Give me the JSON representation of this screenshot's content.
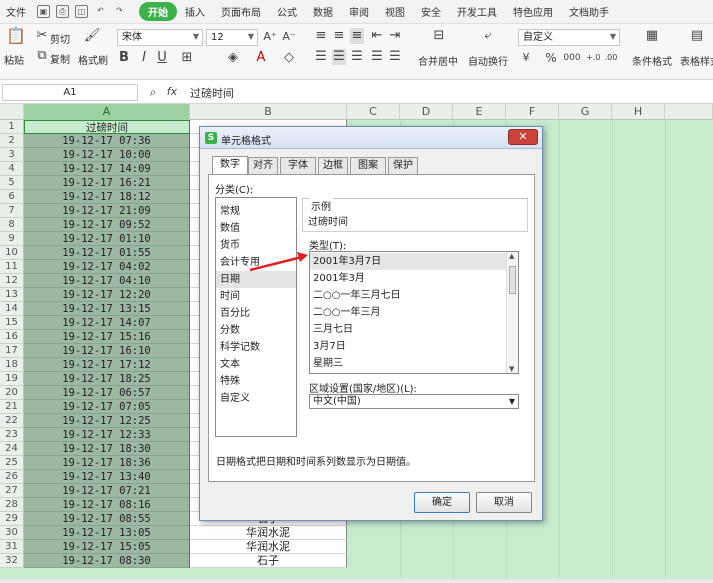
{
  "menu": {
    "file": "文件",
    "items": [
      "开始",
      "插入",
      "页面布局",
      "公式",
      "数据",
      "审阅",
      "视图",
      "安全",
      "开发工具",
      "特色应用",
      "文档助手"
    ],
    "active": "开始"
  },
  "ribbon": {
    "paste": "粘贴",
    "cut": "剪切",
    "copy": "复制",
    "format_painter": "格式刷",
    "font_name": "宋体",
    "font_size": "12",
    "merge_center": "合并居中",
    "wrap": "自动换行",
    "number_format": "自定义",
    "currency": "¥",
    "percent": "%",
    "thousands": "000",
    "conditional": "条件格式",
    "table_style": "表格样式"
  },
  "formula_bar": {
    "cell": "A1",
    "fx": "fx",
    "content": "过磅时间"
  },
  "columns": [
    "A",
    "B",
    "C",
    "D",
    "E",
    "F",
    "G",
    "H"
  ],
  "rows": [
    {
      "n": "1",
      "a": "过磅时间",
      "b": ""
    },
    {
      "n": "2",
      "a": "19-12-17  07:36",
      "b": ""
    },
    {
      "n": "3",
      "a": "19-12-17  10:00",
      "b": ""
    },
    {
      "n": "4",
      "a": "19-12-17  14:09",
      "b": ""
    },
    {
      "n": "5",
      "a": "19-12-17  16:21",
      "b": ""
    },
    {
      "n": "6",
      "a": "19-12-17  18:12",
      "b": ""
    },
    {
      "n": "7",
      "a": "19-12-17  21:09",
      "b": ""
    },
    {
      "n": "8",
      "a": "19-12-17  09:52",
      "b": ""
    },
    {
      "n": "9",
      "a": "19-12-17  01:10",
      "b": ""
    },
    {
      "n": "10",
      "a": "19-12-17  01:55",
      "b": ""
    },
    {
      "n": "11",
      "a": "19-12-17  04:02",
      "b": ""
    },
    {
      "n": "12",
      "a": "19-12-17  04:10",
      "b": ""
    },
    {
      "n": "13",
      "a": "19-12-17  12:20",
      "b": ""
    },
    {
      "n": "14",
      "a": "19-12-17  13:15",
      "b": ""
    },
    {
      "n": "15",
      "a": "19-12-17  14:07",
      "b": ""
    },
    {
      "n": "16",
      "a": "19-12-17  15:16",
      "b": ""
    },
    {
      "n": "17",
      "a": "19-12-17  16:10",
      "b": ""
    },
    {
      "n": "18",
      "a": "19-12-17  17:12",
      "b": ""
    },
    {
      "n": "19",
      "a": "19-12-17  18:25",
      "b": ""
    },
    {
      "n": "20",
      "a": "19-12-17  06:57",
      "b": ""
    },
    {
      "n": "21",
      "a": "19-12-17  07:05",
      "b": ""
    },
    {
      "n": "22",
      "a": "19-12-17  12:25",
      "b": ""
    },
    {
      "n": "23",
      "a": "19-12-17  12:33",
      "b": ""
    },
    {
      "n": "24",
      "a": "19-12-17  18:30",
      "b": ""
    },
    {
      "n": "25",
      "a": "19-12-17  18:36",
      "b": ""
    },
    {
      "n": "26",
      "a": "19-12-17  13:40",
      "b": ""
    },
    {
      "n": "27",
      "a": "19-12-17  07:21",
      "b": ""
    },
    {
      "n": "28",
      "a": "19-12-17  08:16",
      "b": ""
    },
    {
      "n": "29",
      "a": "19-12-17  08:55",
      "b": "石子"
    },
    {
      "n": "30",
      "a": "19-12-17  13:05",
      "b": "华润水泥"
    },
    {
      "n": "31",
      "a": "19-12-17  15:05",
      "b": "华润水泥"
    },
    {
      "n": "32",
      "a": "19-12-17  08:30",
      "b": "石子"
    }
  ],
  "dialog": {
    "title": "单元格格式",
    "close": "✕",
    "tabs": [
      "数字",
      "对齐",
      "字体",
      "边框",
      "图案",
      "保护"
    ],
    "active_tab": "数字",
    "category_label": "分类(C):",
    "categories": [
      "常规",
      "数值",
      "货币",
      "会计专用",
      "日期",
      "时间",
      "百分比",
      "分数",
      "科学记数",
      "文本",
      "特殊",
      "自定义"
    ],
    "selected_category": "日期",
    "sample_label": "示例",
    "sample_value": "过磅时间",
    "type_label": "类型(T):",
    "types": [
      "2001年3月7日",
      "2001年3月",
      "二○○一年三月七日",
      "二○○一年三月",
      "三月七日",
      "3月7日",
      "星期三"
    ],
    "selected_type": "2001年3月7日",
    "locale_label": "区域设置(国家/地区)(L):",
    "locale_value": "中文(中国)",
    "description": "日期格式把日期和时间系列数显示为日期值。",
    "ok": "确定",
    "cancel": "取消"
  },
  "colors": {
    "accent": "#3bb34a",
    "arrow": "#e02020",
    "selection": "#2e8b3e"
  }
}
